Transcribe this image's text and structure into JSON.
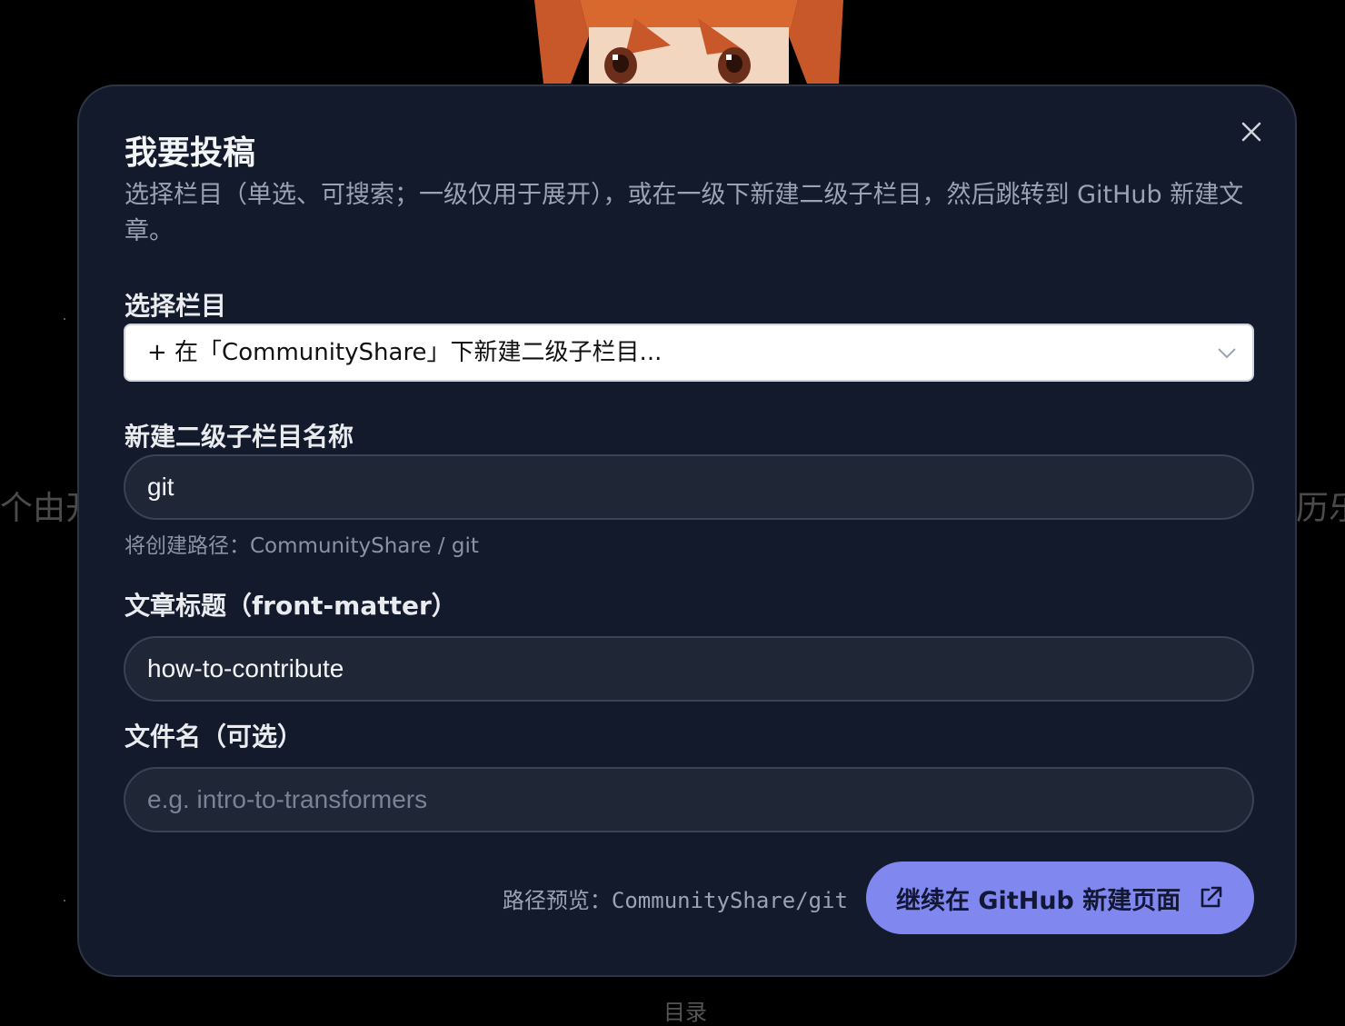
{
  "background": {
    "left_text": "个由开",
    "right_text": "历乐趣",
    "bottom_text": "目录"
  },
  "modal": {
    "title": "我要投稿",
    "description": "选择栏目（单选、可搜索；一级仅用于展开），或在一级下新建二级子栏目，然后跳转到 GitHub 新建文章。",
    "close_icon": "close-icon"
  },
  "category": {
    "label": "选择栏目",
    "selected": "+ 在「CommunityShare」下新建二级子栏目...",
    "chevron_icon": "chevron-down-icon"
  },
  "subcategory": {
    "label": "新建二级子栏目名称",
    "value": "git",
    "hint": "将创建路径：CommunityShare / git"
  },
  "article_title": {
    "label": "文章标题（front-matter）",
    "value": "how-to-contribute"
  },
  "filename": {
    "label": "文件名（可选）",
    "value": "",
    "placeholder": "e.g. intro-to-transformers"
  },
  "footer": {
    "path_preview": "路径预览：CommunityShare/git",
    "submit_label": "继续在 GitHub 新建页面",
    "submit_icon": "external-link-icon"
  },
  "colors": {
    "modal_bg": "#121a2c",
    "accent": "#8088f0",
    "input_bg": "#1f2636"
  }
}
